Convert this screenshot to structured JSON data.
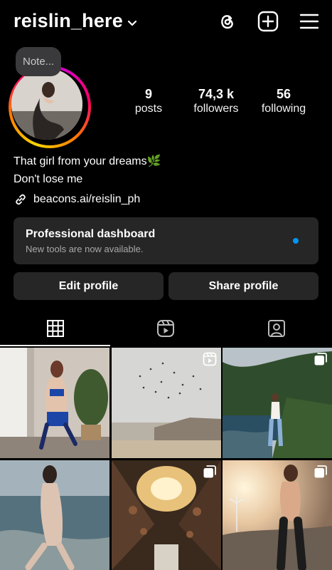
{
  "header": {
    "username": "reislin_here",
    "icons": [
      "chevron-down-icon",
      "threads-icon",
      "new-post-icon",
      "menu-icon"
    ]
  },
  "profile": {
    "note_placeholder": "Note...",
    "stats": [
      {
        "value": "9",
        "label": "posts"
      },
      {
        "value": "74,3 k",
        "label": "followers"
      },
      {
        "value": "56",
        "label": "following"
      }
    ],
    "bio_line1": "That girl from your dreams",
    "bio_emoji": "🌿",
    "bio_line2": "Don't lose me",
    "link": "beacons.ai/reislin_ph"
  },
  "dashboard": {
    "title": "Professional dashboard",
    "subtitle": "New tools are now available.",
    "dot_color": "#0095f6"
  },
  "buttons": {
    "edit": "Edit profile",
    "share": "Share profile"
  },
  "tabs": [
    {
      "name": "grid-icon",
      "selected": true
    },
    {
      "name": "reels-icon",
      "selected": false
    },
    {
      "name": "tagged-icon",
      "selected": false
    }
  ],
  "grid": [
    {
      "type": "photo"
    },
    {
      "type": "reel",
      "overlay": "reel-icon"
    },
    {
      "type": "carousel",
      "overlay": "carousel-icon"
    },
    {
      "type": "photo"
    },
    {
      "type": "carousel",
      "overlay": "carousel-icon"
    },
    {
      "type": "carousel",
      "overlay": "carousel-icon"
    }
  ],
  "colors": {
    "background": "#000000",
    "surface": "#262626",
    "accent": "#0095f6"
  }
}
